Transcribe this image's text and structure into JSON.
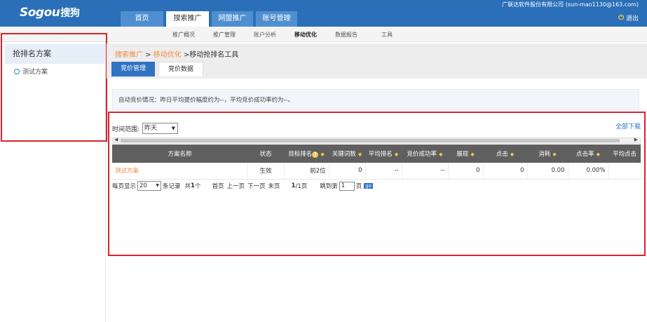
{
  "header": {
    "logo": "Sogou",
    "logo_cn": "搜狗",
    "account": "广联达软件股份有限公司 (sun-mao1130@163.com)",
    "logout": "退出",
    "main_tabs": [
      "首页",
      "搜索推广",
      "网盟推广",
      "账号管理"
    ],
    "sub_nav": [
      "推广概况",
      "推广管理",
      "账户分析",
      "移动优化",
      "数据报告",
      "工具"
    ]
  },
  "sidebar": {
    "title": "抢排名方案",
    "items": [
      {
        "label": "测试方案"
      }
    ]
  },
  "breadcrumb": {
    "part1": "搜索推广",
    "sep1": " > ",
    "part2": "移动优化",
    "sep2": " >",
    "part3": "移动抢排名工具"
  },
  "page_tabs": [
    "竞价管理",
    "竞价数据"
  ],
  "info_text": "自动竞价情况：昨日平均提价幅度约为--，平均竞价成功率约为--。",
  "filter": {
    "label": "时间范围:",
    "value": "昨天",
    "download": "全部下载"
  },
  "table": {
    "columns": [
      "方案名称",
      "状态",
      "目标排名",
      "关键词数",
      "平均排名",
      "竞价成功率",
      "展现",
      "点击",
      "消耗",
      "点击率",
      "平均点击"
    ],
    "rows": [
      [
        "测试方案",
        "生效",
        "前2位",
        "0",
        "--",
        "--",
        "0",
        "0",
        "0.00",
        "0.00%",
        ""
      ]
    ]
  },
  "pager": {
    "per_page_label": "每页显示",
    "per_page_value": "20",
    "records_label": "条记录",
    "total_prefix": "共",
    "total_count": "1",
    "total_suffix": "个",
    "first": "首页",
    "prev": "上一页",
    "next": "下一页",
    "last": "末页",
    "page_cur": "1",
    "page_total": "/1页",
    "jump_label": "跳到第",
    "jump_value": "1",
    "page_unit": "页",
    "go": "go"
  },
  "colors": {
    "accent": "#2a6fb8",
    "highlight": "#d8232a",
    "link_orange": "#f08a3e"
  }
}
